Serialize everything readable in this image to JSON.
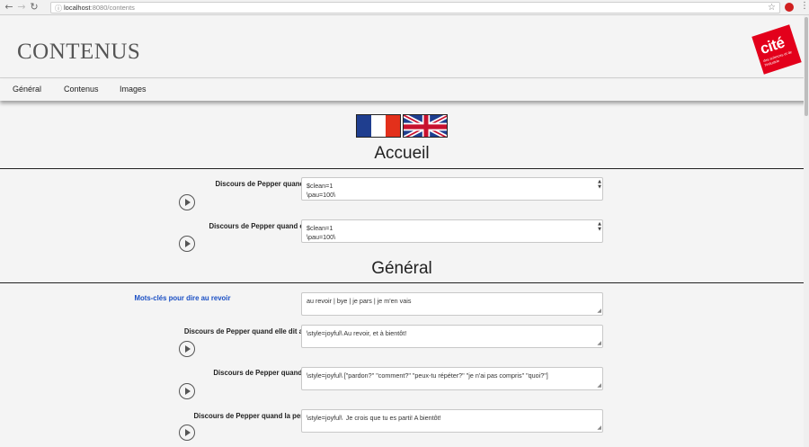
{
  "browser": {
    "url_host": "localhost",
    "url_rest": ":8080/contents",
    "back_icon": "arrow-left",
    "forward_icon": "arrow-right",
    "reload_icon": "reload"
  },
  "header": {
    "title": "CONTENUS",
    "logo_text": "cité",
    "logo_sub": "des sciences et de l'industrie"
  },
  "nav": {
    "items": [
      {
        "label": "Général"
      },
      {
        "label": "Contenus"
      },
      {
        "label": "Images"
      }
    ]
  },
  "languages": [
    "fr",
    "en"
  ],
  "sections": [
    {
      "title": "Accueil",
      "rows": [
        {
          "label": "Discours de Pepper quand elle ne voit personne",
          "value": "$clean=1\n\\pau=100\\",
          "has_play": true
        },
        {
          "label": "Discours de Pepper quand elle aperçoit quelqu'un",
          "value": "$clean=1\n\\pau=100\\",
          "has_play": true
        }
      ]
    },
    {
      "title": "Général",
      "rows": [
        {
          "label": "Mots-clés pour dire au revoir",
          "value": "au revoir | bye | je pars | je m'en vais",
          "has_play": false
        },
        {
          "label": "Discours de Pepper quand elle dit au revoir à la personne",
          "value": "\\style=joyful\\ Au revoir, et à bientôt!",
          "has_play": true
        },
        {
          "label": "Discours de Pepper quand elle ne comprend pas",
          "value": "\\style=joyful\\ [\"pardon?\" \"comment?\" \"peux-tu répéter?\" \"je n'ai pas compris\" \"quoi?\"]",
          "has_play": true
        },
        {
          "label": "Discours de Pepper quand la personne n'interagit plus",
          "value": "\\style=joyful\\  Je crois que tu es parti! A bientôt!",
          "has_play": true
        }
      ]
    }
  ],
  "colors": {
    "accent_link": "#1a4fc4",
    "logo_red": "#e3001b",
    "flag_blue": "#1f3e8f",
    "flag_red": "#e3301b"
  }
}
